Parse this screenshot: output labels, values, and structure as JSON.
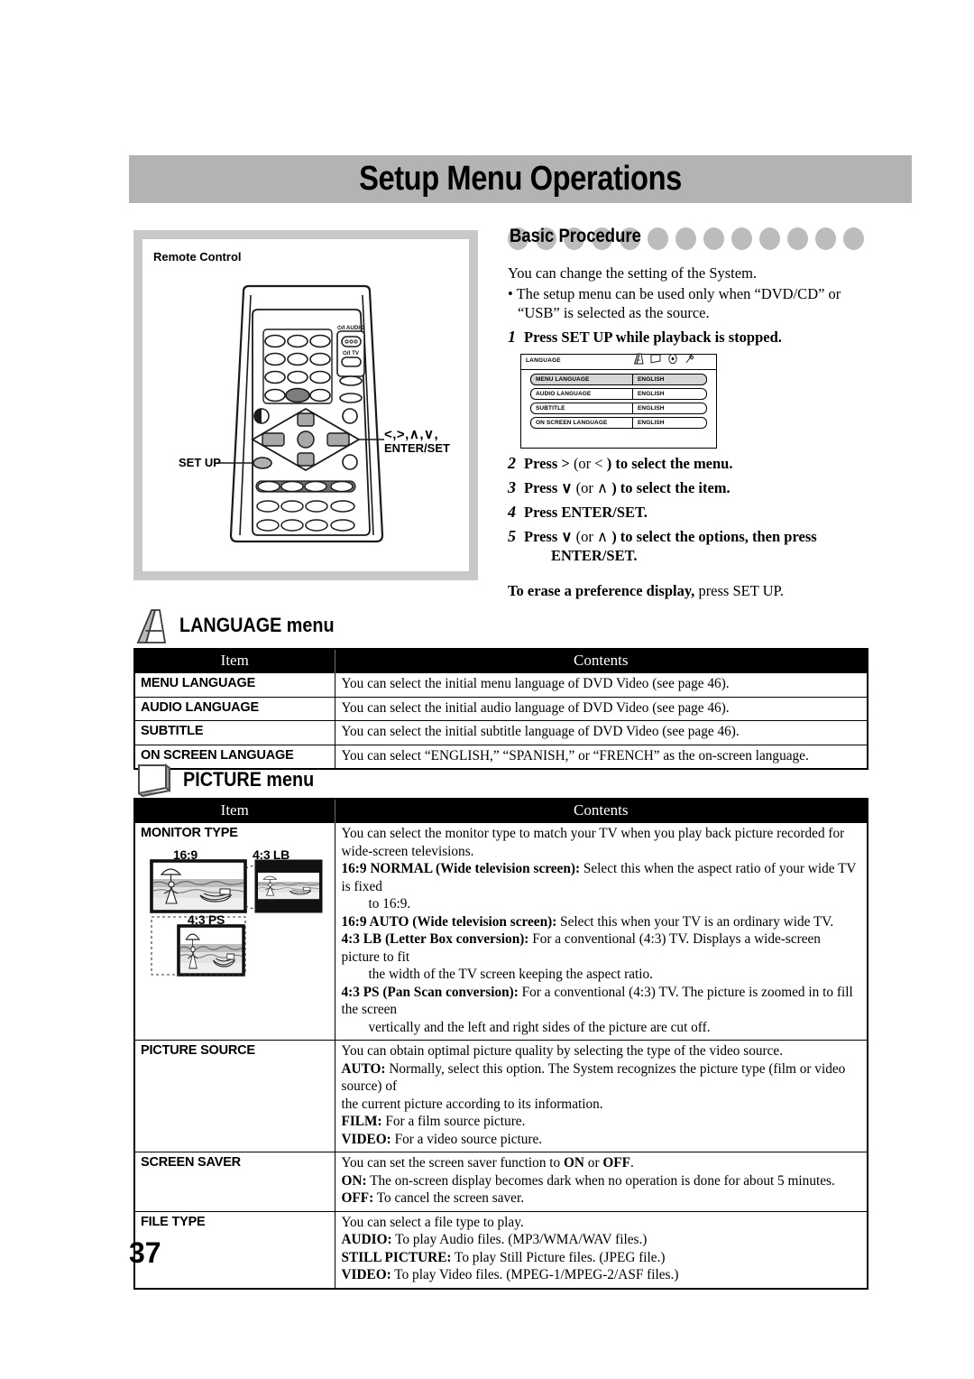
{
  "page": {
    "title": "Setup Menu Operations",
    "number": "37"
  },
  "remote_panel": {
    "label": "Remote Control",
    "callouts": {
      "setup": "SET UP",
      "arrows": "<,>,∧,∨,",
      "enter_set": "ENTER/SET"
    },
    "remote_button_labels": {
      "audio_power": "⏻/I AUDIO",
      "tv_power": "⏻/I TV"
    }
  },
  "basic_procedure": {
    "heading": "Basic Procedure",
    "dot_count": 8,
    "intro": "You can change the setting of the System.",
    "bullet": "• The setup menu can be used only when “DVD/CD” or “USB” is selected as the source.",
    "steps": [
      {
        "num": "1",
        "text": "Press SET UP while playback is stopped."
      },
      {
        "num": "2",
        "text_a": "Press > ",
        "text_reg": "(or < ",
        "text_b": ") to select the menu."
      },
      {
        "num": "3",
        "text_a": "Press ∨ ",
        "text_reg": "(or ∧ ",
        "text_b": ") to select the item."
      },
      {
        "num": "4",
        "text_a": "Press ENTER/SET.",
        "text_reg": "",
        "text_b": ""
      },
      {
        "num": "5",
        "text_a": "Press ∨ ",
        "text_reg": "(or ∧ ",
        "text_b": ") to select the options, then press"
      }
    ],
    "step5_continued": "ENTER/SET.",
    "erase_note_bold": "To erase a preference display,",
    "erase_note_rest": " press SET UP."
  },
  "osd_mock": {
    "tab_title": "LANGUAGE",
    "tab_icons": [
      "language-a-icon",
      "picture-screen-icon",
      "audio-disc-icon",
      "other-wrench-icon"
    ],
    "rows": [
      {
        "key": "MENU LANGUAGE",
        "value": "ENGLISH",
        "selected": true
      },
      {
        "key": "AUDIO LANGUAGE",
        "value": "ENGLISH",
        "selected": false
      },
      {
        "key": "SUBTITLE",
        "value": "ENGLISH",
        "selected": false
      },
      {
        "key": "ON SCREEN LANGUAGE",
        "value": "ENGLISH",
        "selected": false
      }
    ]
  },
  "language_section": {
    "heading": "LANGUAGE menu",
    "icon": "language-a-icon",
    "columns": {
      "item": "Item",
      "contents": "Contents"
    },
    "rows": [
      {
        "item": "MENU LANGUAGE",
        "contents": "You can select the initial menu language of DVD Video (see page 46)."
      },
      {
        "item": "AUDIO LANGUAGE",
        "contents": "You can select the initial audio language of DVD Video (see page 46)."
      },
      {
        "item": "SUBTITLE",
        "contents": "You can select the initial subtitle language of DVD Video (see page 46)."
      },
      {
        "item": "ON SCREEN LANGUAGE",
        "contents": "You can select “ENGLISH,” “SPANISH,” or “FRENCH” as the on-screen language."
      }
    ]
  },
  "picture_section": {
    "heading": "PICTURE menu",
    "icon": "picture-screen-icon",
    "columns": {
      "item": "Item",
      "contents": "Contents"
    },
    "monitor_type": {
      "item": "MONITOR TYPE",
      "figure_captions": [
        "16:9",
        "4:3 LB",
        "4:3 PS"
      ],
      "intro": "You can select the monitor type to match your TV when you play back picture recorded for wide-screen televisions.",
      "opt1_bold": "16:9 NORMAL (Wide television screen):",
      "opt1_rest": " Select this when the aspect ratio of your wide TV is fixed",
      "opt1_cont": "to 16:9.",
      "opt2_bold": "16:9 AUTO (Wide television screen):",
      "opt2_rest": " Select this when your TV is an ordinary wide TV.",
      "opt3_bold": "4:3 LB (Letter Box conversion):",
      "opt3_rest": " For a conventional (4:3) TV. Displays a wide-screen picture to fit",
      "opt3_cont": "the width of the TV screen keeping the aspect ratio.",
      "opt4_bold": "4:3 PS (Pan Scan conversion):",
      "opt4_rest": " For a conventional (4:3) TV. The picture is zoomed in to fill the screen",
      "opt4_cont": "vertically and the left and right sides of the picture are cut off."
    },
    "picture_source": {
      "item": "PICTURE SOURCE",
      "intro": "You can obtain optimal picture quality by selecting the type of the video source.",
      "auto_bold": "AUTO:",
      "auto_rest": " Normally, select this option. The System recognizes the picture type (film or video source) of",
      "auto_cont": "the current picture according to its information.",
      "film_bold": "FILM:",
      "film_rest": " For a film source picture.",
      "video_bold": "VIDEO:",
      "video_rest": " For a video source picture."
    },
    "screen_saver": {
      "item": "SCREEN SAVER",
      "intro_a": "You can set the screen saver function to ",
      "intro_on": "ON",
      "intro_or": " or ",
      "intro_off": "OFF",
      "intro_end": ".",
      "on_bold": "ON:",
      "on_rest": " The on-screen display becomes dark when no operation is done for about 5 minutes.",
      "off_bold": "OFF:",
      "off_rest": " To cancel the screen saver."
    },
    "file_type": {
      "item": "FILE TYPE",
      "intro": "You can select a file type to play.",
      "audio_bold": "AUDIO:",
      "audio_rest": " To play Audio files. (MP3/WMA/WAV files.)",
      "still_bold": "STILL PICTURE:",
      "still_rest": " To play Still Picture files. (JPEG file.)",
      "video_bold": "VIDEO:",
      "video_rest": " To play Video files. (MPEG-1/MPEG-2/ASF files.)"
    }
  }
}
